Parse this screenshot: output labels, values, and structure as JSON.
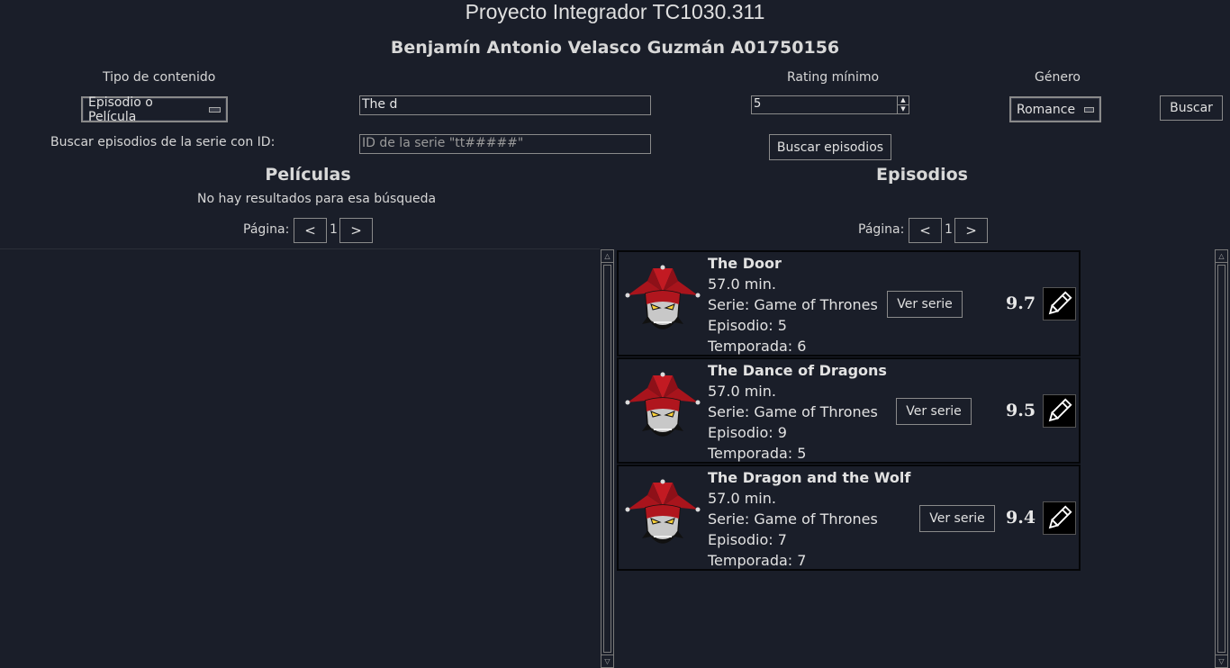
{
  "header": {
    "title": "Proyecto Integrador TC1030.311",
    "author": "Benjamín Antonio Velasco Guzmán A01750156"
  },
  "filters": {
    "tipo_label": "Tipo de contenido",
    "tipo_value": "Episodio o Película",
    "search_value": "The d",
    "rating_label": "Rating mínimo",
    "rating_value": "5",
    "genero_label": "Género",
    "genero_value": "Romance",
    "buscar_button": "Buscar",
    "serie_label": "Buscar episodios de la serie con ID:",
    "serie_placeholder": "ID de la serie \"tt#####\"",
    "buscar_episodios_button": "Buscar episodios"
  },
  "peliculas": {
    "title": "Películas",
    "empty_message": "No hay resultados para esa búsqueda",
    "page_label": "Página:",
    "prev": "<",
    "page": "1",
    "next": ">"
  },
  "episodios": {
    "title": "Episodios",
    "page_label": "Página:",
    "prev": "<",
    "page": "1",
    "next": ">",
    "items": [
      {
        "name": "The Door",
        "duration": "57.0 min.",
        "serie": "Serie: Game of Thrones",
        "episodio": "Episodio: 5",
        "temporada": "Temporada: 6",
        "ver_serie": "Ver serie",
        "rating": "9.7"
      },
      {
        "name": "The Dance of Dragons",
        "duration": "57.0 min.",
        "serie": "Serie: Game of Thrones",
        "episodio": "Episodio: 9",
        "temporada": "Temporada: 5",
        "ver_serie": "Ver serie",
        "rating": "9.5"
      },
      {
        "name": "The Dragon and the Wolf",
        "duration": "57.0 min.",
        "serie": "Serie: Game of Thrones",
        "episodio": "Episodio: 7",
        "temporada": "Temporada: 7",
        "ver_serie": "Ver serie",
        "rating": "9.4"
      }
    ]
  },
  "icons": {
    "thumbnail": "jester-mask-icon",
    "edit": "pencil-icon",
    "combo_indicator": "dropdown-indicator-icon",
    "scroll_up": "scroll-up-arrow-icon",
    "scroll_down": "scroll-down-arrow-icon"
  }
}
